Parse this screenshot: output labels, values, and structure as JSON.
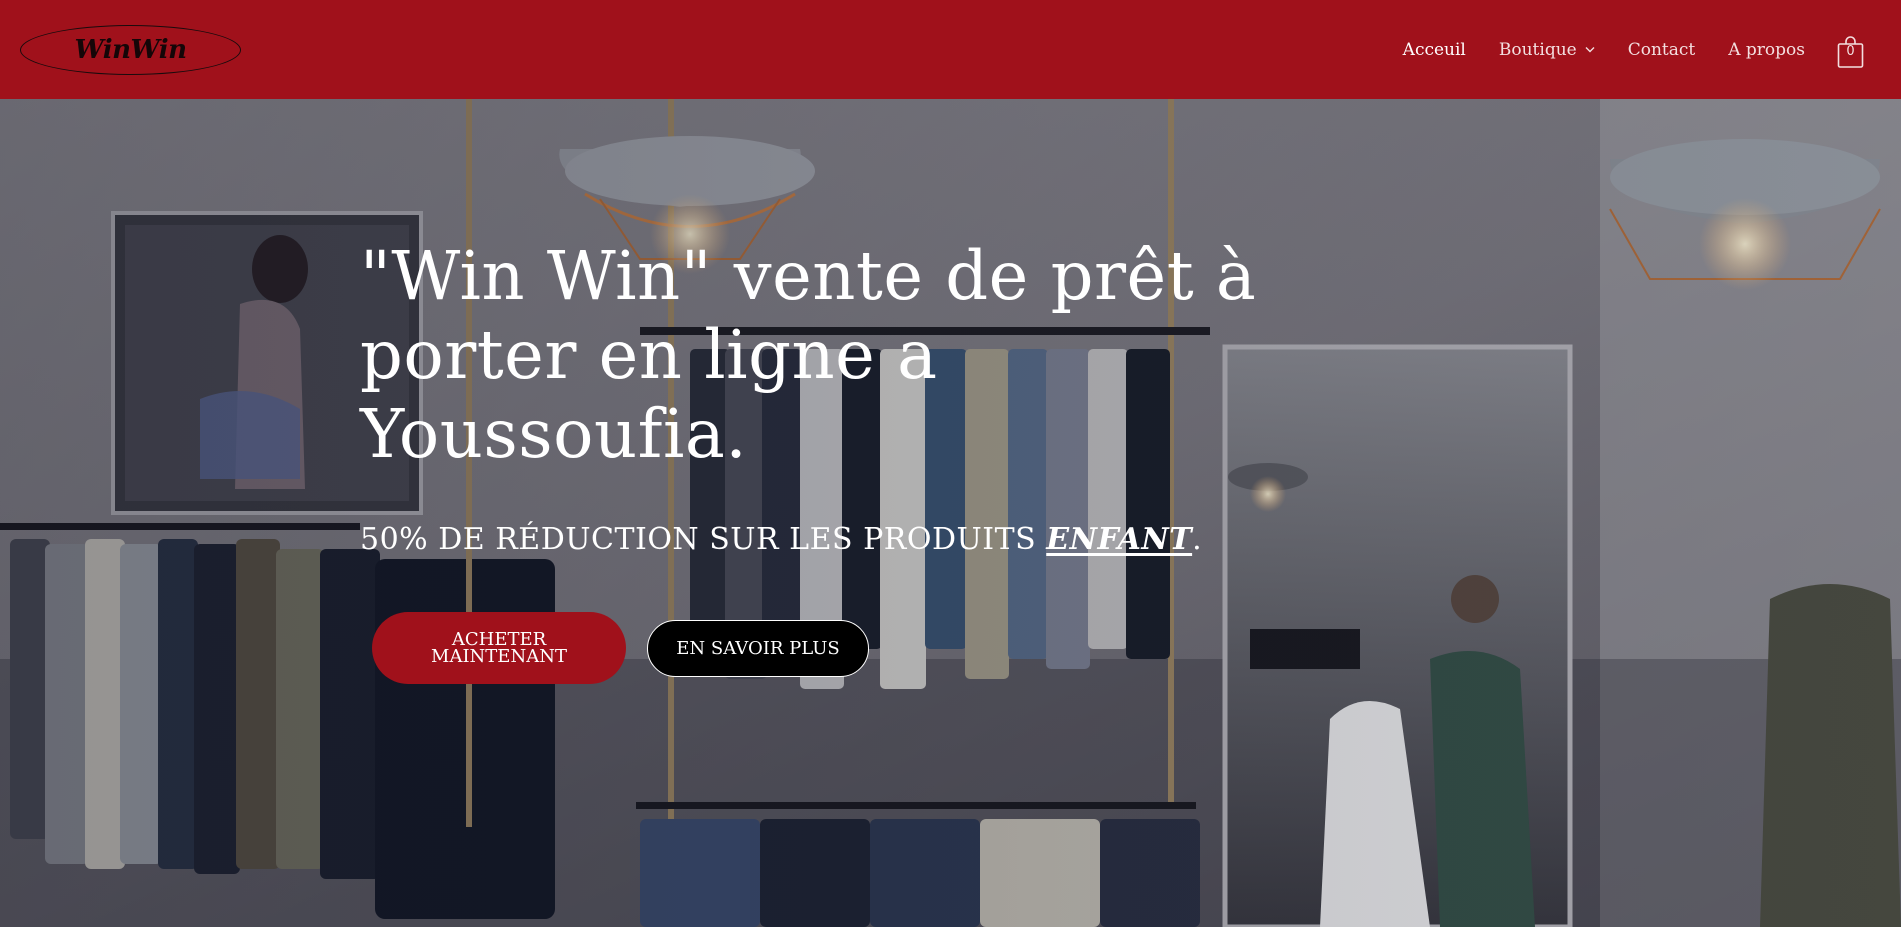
{
  "brand": {
    "logo_text": "WinWin",
    "header_color": "#a0111b"
  },
  "nav": {
    "items": [
      {
        "label": "Acceuil",
        "active": true
      },
      {
        "label": "Boutique",
        "has_dropdown": true
      },
      {
        "label": "Contact"
      },
      {
        "label": "A propos"
      }
    ],
    "cart_count": "0"
  },
  "hero": {
    "title": "\"Win Win\" vente de prêt à porter en ligne a Youssoufia.",
    "subtitle_prefix": "50% DE RÉDUCTION SUR LES PRODUITS ",
    "subtitle_emphasis": "ENFANT",
    "subtitle_suffix": ".",
    "primary_button": "ACHETER MAINTENANT",
    "secondary_button": "EN SAVOIR PLUS"
  }
}
